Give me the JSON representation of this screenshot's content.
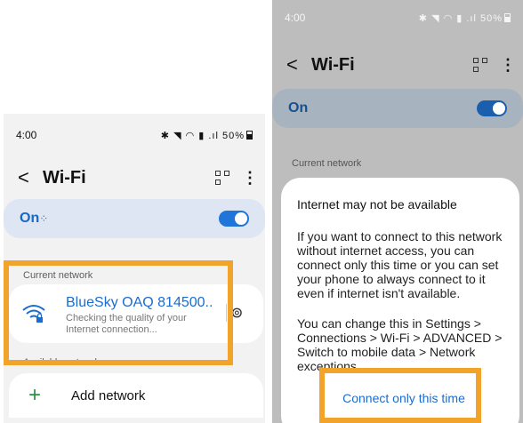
{
  "left": {
    "status": {
      "time": "4:00",
      "battery": "50%"
    },
    "title": "Wi-Fi",
    "on_label": "On",
    "current_network_label": "Current network",
    "network": {
      "name": "BlueSky OAQ 814500..",
      "status": "Checking the quality of your Internet connection..."
    },
    "available_label": "Available networks",
    "add_network_label": "Add network"
  },
  "right": {
    "status": {
      "time": "4:00",
      "battery": "50%"
    },
    "title": "Wi-Fi",
    "on_label": "On",
    "current_network_label": "Current network",
    "dialog": {
      "title": "Internet may not be available",
      "body1": "If you want to connect to this network without internet access, you can connect only this time or you can set your phone to always connect to it even if internet isn't available.",
      "body2": "You can change this in Settings > Connections > Wi-Fi > ADVANCED > Switch to mobile data > Network exceptions.",
      "button": "Connect only this time"
    }
  },
  "colors": {
    "accent": "#1f75d8",
    "highlight": "#f2a42a",
    "network_name": "#1b6ccf"
  }
}
